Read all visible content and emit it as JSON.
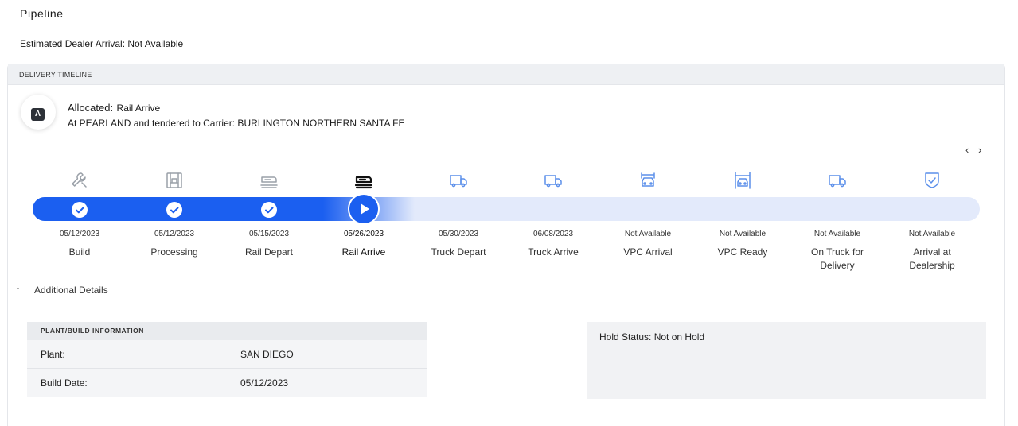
{
  "page_title": "Pipeline",
  "eta": {
    "label": "Estimated Dealer Arrival:",
    "value": "Not Available"
  },
  "timeline": {
    "header": "DELIVERY TIMELINE",
    "status": {
      "badge": "A",
      "label": "Allocated:",
      "value": "Rail Arrive",
      "detail": "At PEARLAND and tendered to Carrier: BURLINGTON NORTHERN SANTA FE"
    },
    "nav": {
      "prev": "‹",
      "next": "›"
    },
    "steps": [
      {
        "date": "05/12/2023",
        "name": "Build",
        "icon": "wrench-icon",
        "state": "done"
      },
      {
        "date": "05/12/2023",
        "name": "Processing",
        "icon": "processing-icon",
        "state": "done"
      },
      {
        "date": "05/15/2023",
        "name": "Rail Depart",
        "icon": "rail-car-icon",
        "state": "done"
      },
      {
        "date": "05/26/2023",
        "name": "Rail Arrive",
        "icon": "rail-car-icon",
        "state": "current"
      },
      {
        "date": "05/30/2023",
        "name": "Truck Depart",
        "icon": "truck-icon",
        "state": "pending"
      },
      {
        "date": "06/08/2023",
        "name": "Truck Arrive",
        "icon": "truck-icon",
        "state": "pending"
      },
      {
        "date": "Not Available",
        "name": "VPC Arrival",
        "icon": "vehicle-icon",
        "state": "pending"
      },
      {
        "date": "Not Available",
        "name": "VPC Ready",
        "icon": "vehicle-lift-icon",
        "state": "pending"
      },
      {
        "date": "Not Available",
        "name": "On Truck for Delivery",
        "icon": "truck-icon",
        "state": "pending"
      },
      {
        "date": "Not Available",
        "name": "Arrival at Dealership",
        "icon": "shield-check-icon",
        "state": "pending"
      }
    ],
    "colors": {
      "progress": "#1b5ff0",
      "track": "#e3eafb",
      "icon_done": "#9aa0a8",
      "icon_current": "#111111",
      "icon_pending": "#5b8fea"
    }
  },
  "additional_details": {
    "toggle_label": "Additional Details",
    "plant": {
      "header": "PLANT/BUILD INFORMATION",
      "rows": [
        {
          "key": "Plant:",
          "value": "SAN DIEGO"
        },
        {
          "key": "Build Date:",
          "value": "05/12/2023"
        }
      ]
    },
    "hold": {
      "label": "Hold Status:",
      "value": "Not on Hold"
    }
  }
}
